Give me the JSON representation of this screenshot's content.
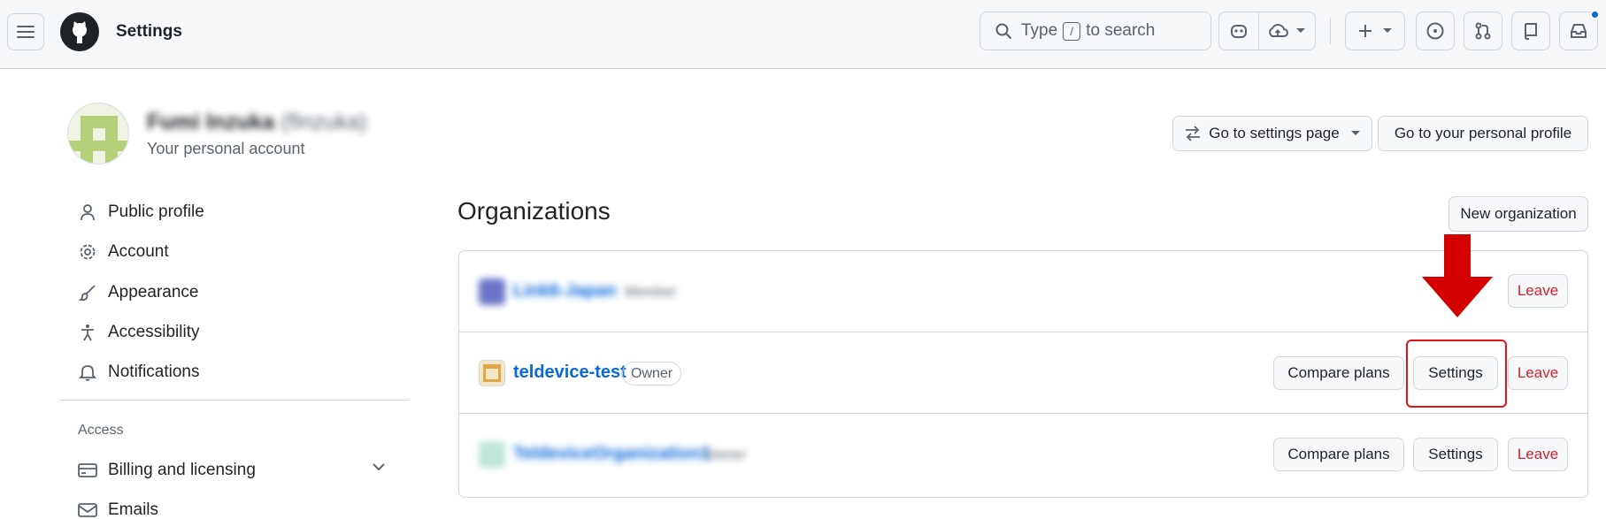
{
  "header": {
    "title": "Settings",
    "search": {
      "prefix": "Type",
      "key": "/",
      "suffix": "to search"
    }
  },
  "profile": {
    "name": "Fumi Inzuka",
    "handle": "(fInzuka)",
    "subtitle": "Your personal account"
  },
  "actions": {
    "goto_settings": "Go to settings page",
    "goto_profile": "Go to your personal profile"
  },
  "sidebar": {
    "items": [
      {
        "label": "Public profile",
        "icon": "person-icon"
      },
      {
        "label": "Account",
        "icon": "gear-icon"
      },
      {
        "label": "Appearance",
        "icon": "paintbrush-icon"
      },
      {
        "label": "Accessibility",
        "icon": "accessibility-icon"
      },
      {
        "label": "Notifications",
        "icon": "bell-icon"
      }
    ],
    "section_heading": "Access",
    "access_items": [
      {
        "label": "Billing and licensing",
        "icon": "credit-card-icon"
      },
      {
        "label": "Emails",
        "icon": "mail-icon"
      }
    ]
  },
  "organizations": {
    "heading": "Organizations",
    "new_button": "New organization",
    "rows": [
      {
        "name": "Link6-Japan",
        "role": "Member",
        "compare": "",
        "settings": "",
        "leave": "Leave",
        "blurred": true
      },
      {
        "name": "teldevice-test",
        "role": "Owner",
        "compare": "Compare plans",
        "settings": "Settings",
        "leave": "Leave",
        "blurred": false
      },
      {
        "name": "TeldeviceOrganization1",
        "role": "Owner",
        "compare": "Compare plans",
        "settings": "Settings",
        "leave": "Leave",
        "blurred": true
      }
    ]
  },
  "colors": {
    "accent": "#0969da",
    "danger": "#cf222e",
    "annotation": "#e0121a"
  }
}
